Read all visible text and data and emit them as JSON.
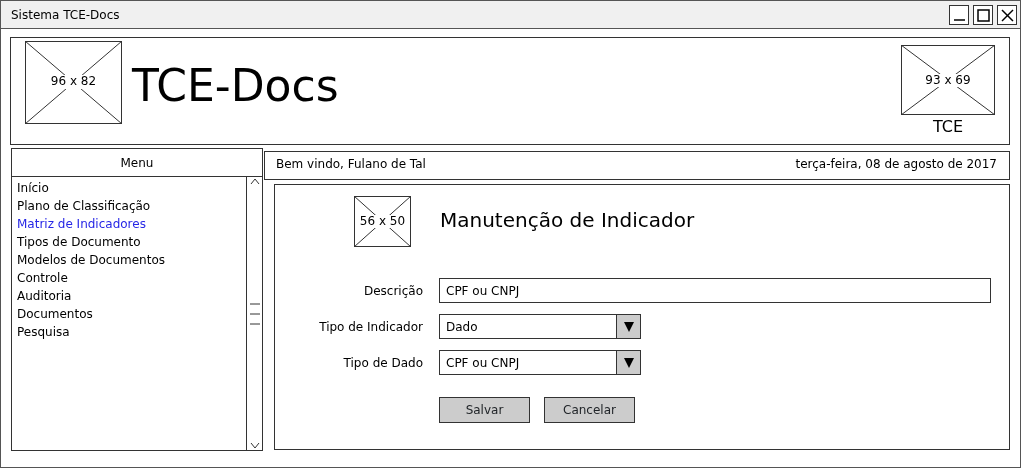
{
  "window": {
    "title": "Sistema TCE-Docs"
  },
  "header": {
    "logo_placeholder": {
      "label": "96 x 82"
    },
    "title": "TCE-Docs",
    "right_placeholder": {
      "label": "93 x 69",
      "caption": "TCE"
    }
  },
  "menu": {
    "title": "Menu",
    "items": [
      {
        "label": "Início",
        "selected": false
      },
      {
        "label": "Plano de Classificação",
        "selected": false
      },
      {
        "label": "Matriz de Indicadores",
        "selected": true
      },
      {
        "label": "Tipos de Documento",
        "selected": false
      },
      {
        "label": "Modelos de Documentos",
        "selected": false
      },
      {
        "label": "Controle",
        "selected": false
      },
      {
        "label": "Auditoria",
        "selected": false
      },
      {
        "label": "Documentos",
        "selected": false
      },
      {
        "label": "Pesquisa",
        "selected": false
      }
    ]
  },
  "welcome": {
    "greeting": "Bem vindo, Fulano de Tal",
    "date": "terça-feira, 08 de agosto de 2017"
  },
  "form": {
    "image_placeholder": {
      "label": "56 x 50"
    },
    "title": "Manutenção de Indicador",
    "fields": [
      {
        "kind": "text",
        "label": "Descrição",
        "value": "CPF ou CNPJ"
      },
      {
        "kind": "select",
        "label": "Tipo de Indicador",
        "value": "Dado"
      },
      {
        "kind": "select",
        "label": "Tipo de Dado",
        "value": "CPF ou CNPJ"
      }
    ],
    "buttons": [
      "Salvar",
      "Cancelar"
    ]
  }
}
